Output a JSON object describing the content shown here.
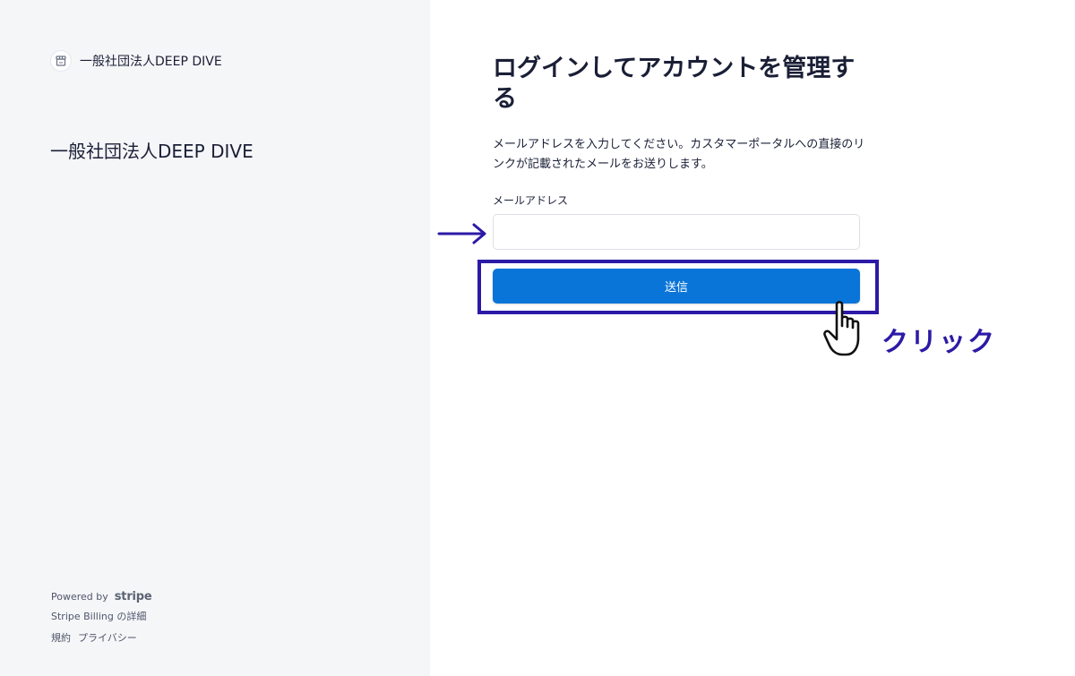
{
  "sidebar": {
    "brand": {
      "logo_icon": "storefront-icon",
      "name": "一般社団法人DEEP DIVE"
    },
    "business_name": "一般社団法人DEEP DIVE",
    "footer": {
      "powered_by": "Powered by",
      "stripe_logo": "stripe",
      "billing_info": "Stripe Billing の詳細",
      "links": [
        "規約",
        "プライバシー"
      ]
    }
  },
  "main": {
    "heading": "ログインしてアカウントを管理する",
    "description": "メールアドレスを入力してください。カスタマーポータルへの直接のリンクが記載されたメールをお送りします。",
    "email": {
      "label": "メールアドレス",
      "value": "",
      "placeholder": ""
    },
    "submit_label": "送信"
  },
  "annotations": {
    "arrow_icon": "right-arrow-icon",
    "hand_icon": "pointing-hand-icon",
    "click_text": "クリック",
    "accent_color": "#2c1aa6"
  },
  "colors": {
    "sidebar_bg": "#f5f6f8",
    "button_bg": "#0a75d8",
    "text": "#1a1f36"
  }
}
